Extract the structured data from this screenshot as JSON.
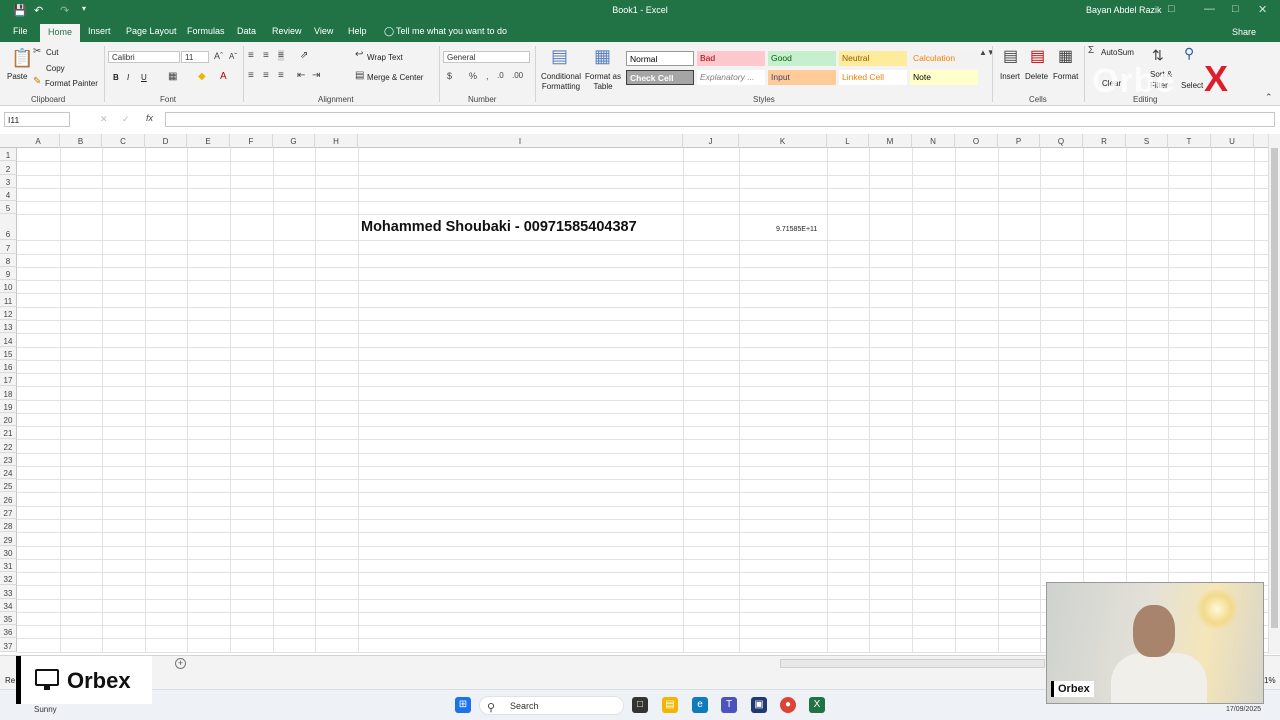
{
  "window": {
    "title": "Book1 - Excel",
    "user": "Bayan Abdel Razik"
  },
  "tabs": [
    "File",
    "Home",
    "Insert",
    "Page Layout",
    "Formulas",
    "Data",
    "Review",
    "View",
    "Help"
  ],
  "active_tab": "Home",
  "tell_me": "Tell me what you want to do",
  "share": "Share",
  "ribbon": {
    "clipboard": {
      "paste": "Paste",
      "cut": "Cut",
      "copy": "Copy",
      "format_painter": "Format Painter",
      "label": "Clipboard"
    },
    "font": {
      "name": "Calibri",
      "size": "11",
      "bold": "B",
      "italic": "I",
      "underline": "U",
      "label": "Font"
    },
    "alignment": {
      "wrap_text": "Wrap Text",
      "merge_center": "Merge & Center",
      "label": "Alignment"
    },
    "number": {
      "format": "General",
      "label": "Number"
    },
    "styles": {
      "conditional": "Conditional Formatting",
      "format_as_table": "Format as Table",
      "label": "Styles",
      "cells": [
        {
          "text": "Normal",
          "bg": "#ffffff",
          "fg": "#000000"
        },
        {
          "text": "Bad",
          "bg": "#ffc7ce",
          "fg": "#9c0006"
        },
        {
          "text": "Good",
          "bg": "#c6efce",
          "fg": "#006100"
        },
        {
          "text": "Neutral",
          "bg": "#ffeb9c",
          "fg": "#9c5700"
        },
        {
          "text": "Calculation",
          "bg": "#f2f2f2",
          "fg": "#fa7d00"
        },
        {
          "text": "Check Cell",
          "bg": "#a5a5a5",
          "fg": "#ffffff"
        },
        {
          "text": "Explanatory ...",
          "bg": "#ffffff",
          "fg": "#7f7f7f"
        },
        {
          "text": "Input",
          "bg": "#ffcc99",
          "fg": "#3f3f76"
        },
        {
          "text": "Linked Cell",
          "bg": "#ffffff",
          "fg": "#fa7d00"
        },
        {
          "text": "Note",
          "bg": "#ffffcc",
          "fg": "#000000"
        }
      ]
    },
    "cells": {
      "insert": "Insert",
      "delete": "Delete",
      "format": "Format",
      "label": "Cells"
    },
    "editing": {
      "autosum": "AutoSum",
      "clear": "Clear",
      "sort": "Sort &",
      "filter": "Filter",
      "select": "Select",
      "label": "Editing"
    }
  },
  "formula_bar": {
    "name_box": "I11",
    "fx": "fx",
    "value": ""
  },
  "columns": [
    "A",
    "B",
    "C",
    "D",
    "E",
    "F",
    "G",
    "H",
    "I",
    "J",
    "K",
    "L",
    "M",
    "N",
    "O",
    "P",
    "Q",
    "R",
    "S",
    "T",
    "U"
  ],
  "rows": [
    "1",
    "2",
    "3",
    "4",
    "5",
    "6",
    "7",
    "8",
    "9",
    "10",
    "11",
    "12",
    "13",
    "14",
    "15",
    "16",
    "17",
    "18",
    "19",
    "20",
    "21",
    "22",
    "23",
    "24",
    "25",
    "26",
    "27",
    "28",
    "29",
    "30",
    "31",
    "32",
    "33",
    "34",
    "35",
    "36",
    "37"
  ],
  "cells": {
    "I6": "Mohammed  Shoubaki - 00971585404387",
    "K6": "9.71585E+11"
  },
  "overlay": {
    "logo_text": "Orbex",
    "webcam_tag": "Orbex",
    "watermark": "Orbe",
    "watermark_x": "X"
  },
  "status": {
    "ready": "Re"
  },
  "taskbar": {
    "weather": "Sunny",
    "search": "Search",
    "date": "17/09/2025",
    "zoom_fragment": "1%"
  }
}
